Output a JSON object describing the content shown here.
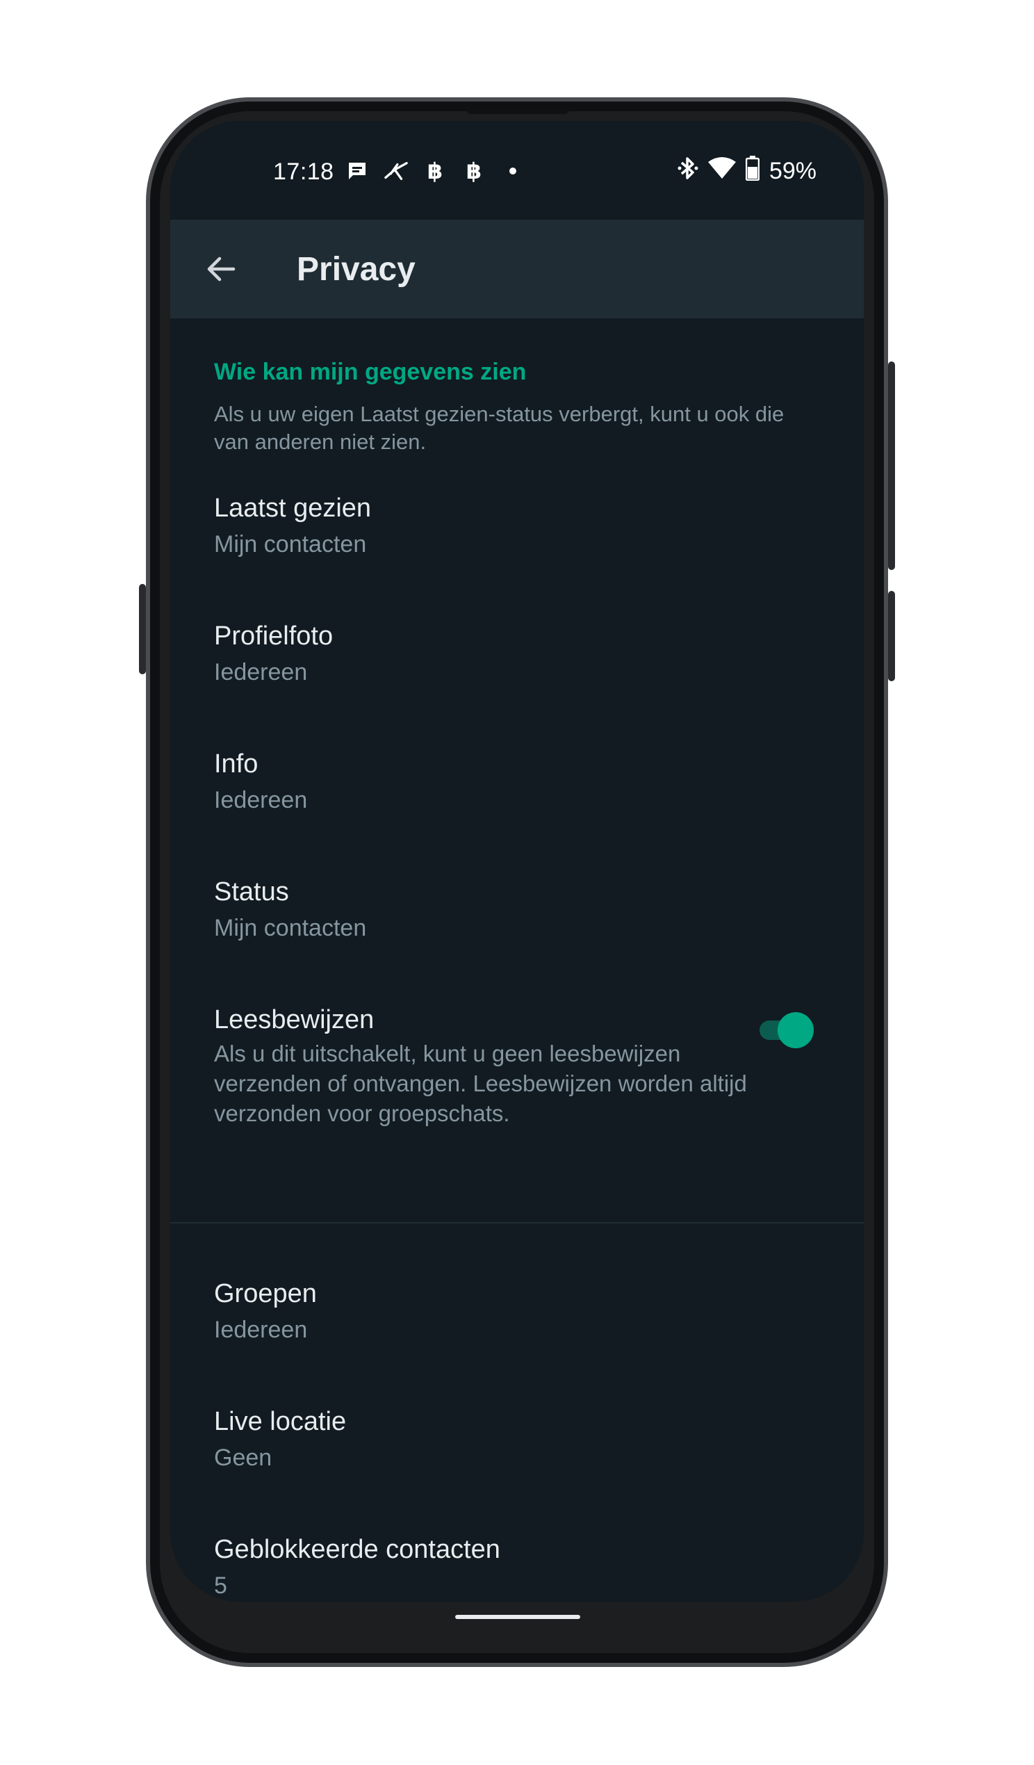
{
  "status_bar": {
    "time": "17:18",
    "battery_percent": "59%",
    "left_icons": [
      "chat-notification-icon",
      "app-notification-icon",
      "bitcoin-icon",
      "bitcoin-icon",
      "more-notifications-dot-icon"
    ],
    "right_icons": [
      "bluetooth-icon",
      "wifi-icon",
      "battery-icon"
    ]
  },
  "app_bar": {
    "title": "Privacy",
    "back_icon": "arrow-left-icon"
  },
  "section": {
    "header": "Wie kan mijn gegevens zien",
    "description": "Als u uw eigen Laatst gezien-status verbergt, kunt u ook die van anderen niet zien."
  },
  "settings": [
    {
      "title": "Laatst gezien",
      "value": "Mijn contacten"
    },
    {
      "title": "Profielfoto",
      "value": "Iedereen"
    },
    {
      "title": "Info",
      "value": "Iedereen"
    },
    {
      "title": "Status",
      "value": "Mijn contacten"
    }
  ],
  "read_receipts": {
    "title": "Leesbewijzen",
    "description": "Als u dit uitschakelt, kunt u geen leesbewijzen verzenden of ontvangen. Leesbewijzen worden altijd verzonden voor groepschats.",
    "enabled": true
  },
  "settings_2": [
    {
      "title": "Groepen",
      "value": "Iedereen"
    },
    {
      "title": "Live locatie",
      "value": "Geen"
    },
    {
      "title": "Geblokkeerde contacten",
      "value": "5"
    }
  ],
  "colors": {
    "background": "#111b21",
    "app_bar": "#202c33",
    "accent": "#00a884",
    "primary_text": "#e9edef",
    "secondary_text": "#8696a0"
  }
}
